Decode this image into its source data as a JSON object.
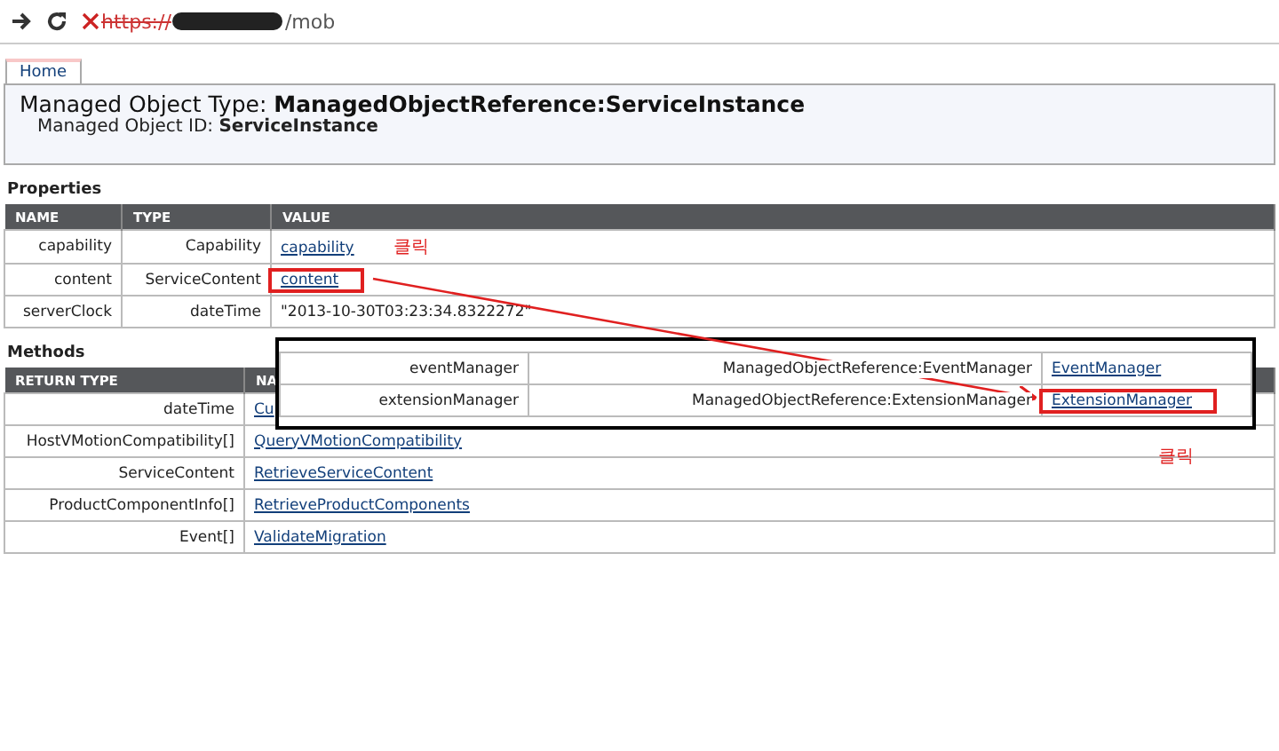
{
  "address_bar": {
    "scheme": "https://",
    "path": "/mob"
  },
  "home_tab": {
    "label": "Home",
    "selected": true
  },
  "header": {
    "type_label": "Managed Object Type:",
    "type_value": "ManagedObjectReference:ServiceInstance",
    "id_label": "Managed Object ID:",
    "id_value": "ServiceInstance"
  },
  "properties": {
    "title": "Properties",
    "columns": [
      "NAME",
      "TYPE",
      "VALUE"
    ],
    "rows": [
      {
        "name": "capability",
        "type": "Capability",
        "value": "capability",
        "kind": "link",
        "note": "클릭",
        "highlighted": false
      },
      {
        "name": "content",
        "type": "ServiceContent",
        "value": "content",
        "kind": "link",
        "highlighted": true
      },
      {
        "name": "serverClock",
        "type": "dateTime",
        "value": "\"2013-10-30T03:23:34.8322272\"",
        "kind": "text"
      }
    ]
  },
  "methods": {
    "title": "Methods",
    "columns": [
      "RETURN TYPE",
      "NA"
    ],
    "rows": [
      {
        "return_type": "dateTime",
        "name": "Cu"
      },
      {
        "return_type": "HostVMotionCompatibility[]",
        "name": "QueryVMotionCompatibility"
      },
      {
        "return_type": "ServiceContent",
        "name": "RetrieveServiceContent"
      },
      {
        "return_type": "ProductComponentInfo[]",
        "name": "RetrieveProductComponents"
      },
      {
        "return_type": "Event[]",
        "name": "ValidateMigration"
      }
    ]
  },
  "inset": {
    "rows": [
      {
        "name": "eventManager",
        "type": "ManagedObjectReference:EventManager",
        "value": "EventManager",
        "highlighted": false
      },
      {
        "name": "extensionManager",
        "type": "ManagedObjectReference:ExtensionManager",
        "value": "ExtensionManager",
        "highlighted": true
      }
    ],
    "note": "클릭"
  }
}
